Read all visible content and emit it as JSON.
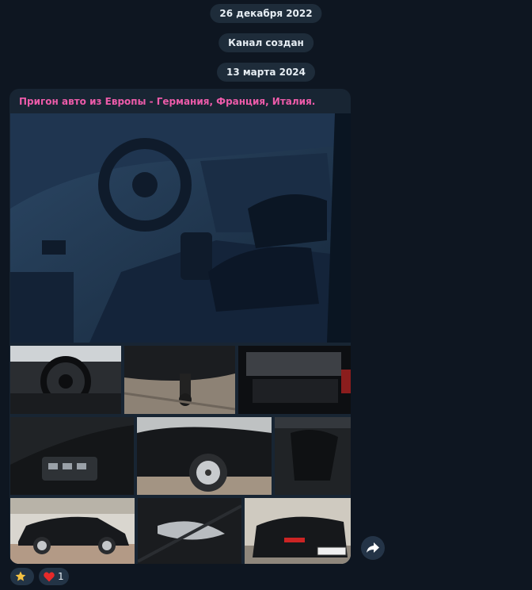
{
  "dates": {
    "date1": "26 декабря 2022",
    "service": "Канал создан",
    "date2": "13 марта 2024"
  },
  "message": {
    "caption": "Пригон авто из Европы - Германия, Франция, Италия.",
    "photos": [
      "main-interior-photo",
      "steering-wheel-photo",
      "towbar-photo",
      "trunk-photo",
      "door-panel-photo",
      "car-front-photo",
      "seats-photo",
      "car-side-photo",
      "door-handle-photo",
      "car-rear-photo"
    ]
  },
  "reactions": [
    {
      "icon": "star-icon",
      "count": ""
    },
    {
      "icon": "heart-icon",
      "count": "1"
    }
  ],
  "colors": {
    "background": "#0e1621",
    "bubble": "#182533",
    "caption": "#ec5ba9",
    "pill": "#1e2c3a"
  }
}
